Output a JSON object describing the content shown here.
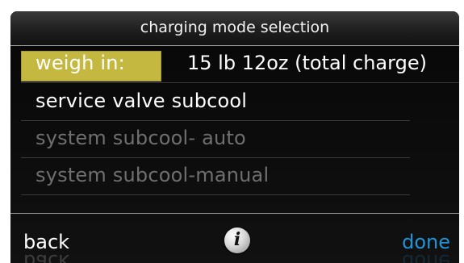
{
  "header": {
    "title": "charging mode selection"
  },
  "options": [
    {
      "label": "weigh in:",
      "value": "15 lb 12oz (total charge)",
      "state": "selected"
    },
    {
      "label": "service valve subcool",
      "state": "enabled"
    },
    {
      "label": "system subcool- auto",
      "state": "disabled"
    },
    {
      "label": "system subcool-manual",
      "state": "disabled"
    }
  ],
  "footer": {
    "back_label": "back",
    "done_label": "done",
    "info_icon": "info-icon"
  },
  "colors": {
    "highlight": "#c4b840",
    "done": "#1f95d6",
    "disabled_text": "#6f6f6f"
  }
}
